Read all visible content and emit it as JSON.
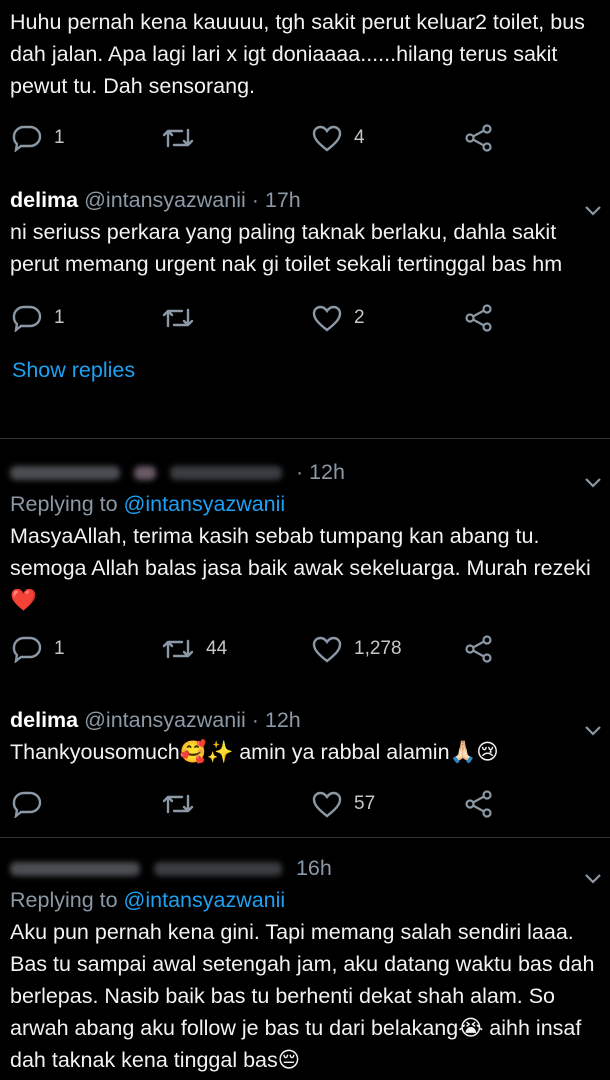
{
  "tweets": [
    {
      "text": "Huhu pernah kena kauuuu, tgh sakit perut keluar2 toilet, bus dah jalan. Apa lagi lari x igt doniaaaa......hilang terus sakit pewut tu.  Dah sensorang.",
      "replies": "1",
      "retweets": "",
      "likes": "4"
    },
    {
      "name": "delima",
      "handle": "@intansyazwanii",
      "time": "· 17h",
      "text": "ni seriuss perkara yang paling taknak berlaku, dahla sakit perut memang urgent nak gi toilet sekali tertinggal bas hm",
      "replies": "1",
      "retweets": "",
      "likes": "2",
      "show_replies": "Show replies"
    },
    {
      "time": "· 12h",
      "replying_prefix": "Replying to ",
      "replying_to": "@intansyazwanii",
      "text": "MasyaAllah, terima kasih sebab tumpang kan abang tu. semoga Allah balas jasa baik awak sekeluarga. Murah rezeki",
      "emoji": "❤️",
      "replies": "1",
      "retweets": "44",
      "likes": "1,278"
    },
    {
      "name": "delima",
      "handle": "@intansyazwanii",
      "time": "· 12h",
      "text": "Thankyousomuch🥰✨ amin ya rabbal alamin🙏🏻😢",
      "replies": "",
      "retweets": "",
      "likes": "57"
    },
    {
      "time": "16h",
      "replying_prefix": "Replying to ",
      "replying_to": "@intansyazwanii",
      "text": "Aku pun pernah kena gini. Tapi memang salah sendiri laaa. Bas tu sampai awal setengah jam, aku datang waktu bas dah berlepas. Nasib baik bas tu berhenti dekat shah alam. So arwah abang aku follow je bas tu dari belakang😭 aihh insaf dah taknak kena tinggal bas😔"
    }
  ],
  "icons": {
    "reply": "reply-icon",
    "retweet": "retweet-icon",
    "like": "heart-icon",
    "share": "share-icon",
    "more": "chevron-down-icon"
  },
  "colors": {
    "background": "#000000",
    "link": "#1da1f2",
    "muted": "#8b98a5",
    "icon": "#8b98a5"
  }
}
